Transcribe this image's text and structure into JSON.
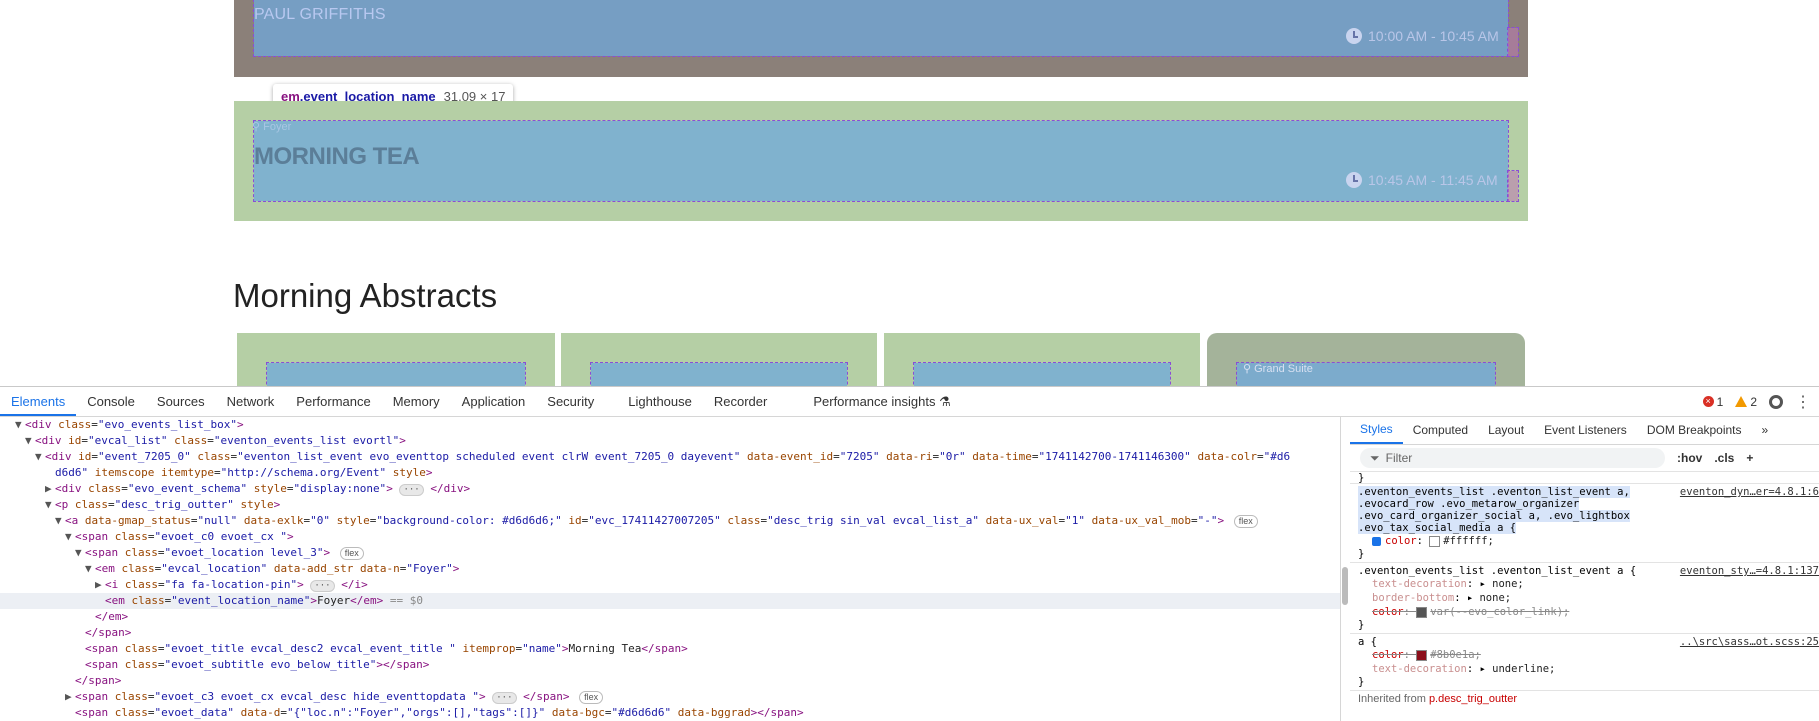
{
  "page": {
    "card1": {
      "organizer": "PAUL GRIFFITHS",
      "time": "10:00 AM - 10:45 AM"
    },
    "card2": {
      "location": "Foyer",
      "title": "MORNING TEA",
      "time": "10:45 AM - 11:45 AM"
    },
    "tooltip": {
      "tag": "em",
      "class": ".event_location_name",
      "dims": "31.09 × 17"
    },
    "section_heading": "Morning Abstracts",
    "abstract_cards": [
      {
        "color": "#b5cfa5",
        "label": ""
      },
      {
        "color": "#b5cfa5",
        "label": ""
      },
      {
        "color": "#b5cfa5",
        "label": ""
      },
      {
        "color": "#a4b39a",
        "label": "Grand Suite"
      }
    ]
  },
  "devtools": {
    "tabs": [
      "Elements",
      "Console",
      "Sources",
      "Network",
      "Performance",
      "Memory",
      "Application",
      "Security",
      "Lighthouse",
      "Recorder",
      "Performance insights"
    ],
    "active_tab": "Elements",
    "errors": "1",
    "warnings": "2",
    "style_tabs": [
      "Styles",
      "Computed",
      "Layout",
      "Event Listeners",
      "DOM Breakpoints"
    ],
    "filter_placeholder": "Filter",
    "filter_hov": ":hov",
    "filter_cls": ".cls",
    "dom_lines": [
      {
        "indent": 2,
        "tri": "▼",
        "html": "<span class=\"t\">&lt;div</span> <span class=\"an\">class</span>=<span class=\"av\">\"evo_events_list_box\"</span><span class=\"t\">&gt;</span>"
      },
      {
        "indent": 3,
        "tri": "▼",
        "html": "<span class=\"t\">&lt;div</span> <span class=\"an\">id</span>=<span class=\"av\">\"evcal_list\"</span> <span class=\"an\">class</span>=<span class=\"av\">\"eventon_events_list evortl\"</span><span class=\"t\">&gt;</span>"
      },
      {
        "indent": 4,
        "tri": "▼",
        "html": "<span class=\"t\">&lt;div</span> <span class=\"an\">id</span>=<span class=\"av\">\"event_7205_0\"</span> <span class=\"an\">class</span>=<span class=\"av\">\"eventon_list_event evo_eventtop scheduled event clrW event_7205_0 dayevent\"</span> <span class=\"an\">data-event_id</span>=<span class=\"av\">\"7205\"</span> <span class=\"an\">data-ri</span>=<span class=\"av\">\"0r\"</span> <span class=\"an\">data-time</span>=<span class=\"av\">\"1741142700-1741146300\"</span> <span class=\"an\">data-colr</span>=<span class=\"av\">\"#d6</span>"
      },
      {
        "indent": 5,
        "tri": "",
        "html": "<span class=\"av\">d6d6\"</span> <span class=\"an\">itemscope</span> <span class=\"an\">itemtype</span>=<span class=\"av\">\"http://schema.org/Event\"</span> <span class=\"an\">style</span><span class=\"t\">&gt;</span>"
      },
      {
        "indent": 5,
        "tri": "▶",
        "html": "<span class=\"t\">&lt;div</span> <span class=\"an\">class</span>=<span class=\"av\">\"evo_event_schema\"</span> <span class=\"an\">style</span>=<span class=\"av\">\"display:none\"</span><span class=\"t\">&gt;</span> <span class=\"ell\">···</span> <span class=\"t\">&lt;/div&gt;</span>"
      },
      {
        "indent": 5,
        "tri": "▼",
        "html": "<span class=\"t\">&lt;p</span> <span class=\"an\">class</span>=<span class=\"av\">\"desc_trig_outter\"</span> <span class=\"an\">style</span><span class=\"t\">&gt;</span>"
      },
      {
        "indent": 6,
        "tri": "▼",
        "html": "<span class=\"t\">&lt;a</span> <span class=\"an\">data-gmap_status</span>=<span class=\"av\">\"null\"</span> <span class=\"an\">data-exlk</span>=<span class=\"av\">\"0\"</span> <span class=\"an\">style</span>=<span class=\"av\">\"background-color: #d6d6d6;\"</span> <span class=\"an\">id</span>=<span class=\"av\">\"evc_17411427007205\"</span> <span class=\"an\">class</span>=<span class=\"av\">\"desc_trig sin_val evcal_list_a\"</span> <span class=\"an\">data-ux_val</span>=<span class=\"av\">\"1\"</span> <span class=\"an\">data-ux_val_mob</span>=<span class=\"av\">\"-\"</span><span class=\"t\">&gt;</span> <span class=\"badge\">flex</span>"
      },
      {
        "indent": 7,
        "tri": "▼",
        "html": "<span class=\"t\">&lt;span</span> <span class=\"an\">class</span>=<span class=\"av\">\"evoet_c0 evoet_cx \"</span><span class=\"t\">&gt;</span>"
      },
      {
        "indent": 8,
        "tri": "▼",
        "html": "<span class=\"t\">&lt;span</span> <span class=\"an\">class</span>=<span class=\"av\">\"evoet_location level_3\"</span><span class=\"t\">&gt;</span> <span class=\"badge\">flex</span>"
      },
      {
        "indent": 9,
        "tri": "▼",
        "html": "<span class=\"t\">&lt;em</span> <span class=\"an\">class</span>=<span class=\"av\">\"evcal_location\"</span> <span class=\"an\">data-add_str</span> <span class=\"an\">data-n</span>=<span class=\"av\">\"Foyer\"</span><span class=\"t\">&gt;</span>"
      },
      {
        "indent": 10,
        "tri": "▶",
        "html": "<span class=\"t\">&lt;i</span> <span class=\"an\">class</span>=<span class=\"av\">\"fa fa-location-pin\"</span><span class=\"t\">&gt;</span> <span class=\"ell\">···</span> <span class=\"t\">&lt;/i&gt;</span>"
      },
      {
        "indent": 10,
        "tri": "",
        "selected": true,
        "html": "<span class=\"t\">&lt;em</span> <span class=\"an\">class</span>=<span class=\"av\">\"event_location_name\"</span><span class=\"t\">&gt;</span><span class=\"txt\">Foyer</span><span class=\"t\">&lt;/em&gt;</span> <span class=\"dollar\">== $0</span>"
      },
      {
        "indent": 9,
        "tri": "",
        "html": "<span class=\"t\">&lt;/em&gt;</span>"
      },
      {
        "indent": 8,
        "tri": "",
        "html": "<span class=\"t\">&lt;/span&gt;</span>"
      },
      {
        "indent": 8,
        "tri": "",
        "html": "<span class=\"t\">&lt;span</span> <span class=\"an\">class</span>=<span class=\"av\">\"evoet_title evcal_desc2 evcal_event_title \"</span> <span class=\"an\">itemprop</span>=<span class=\"av\">\"name\"</span><span class=\"t\">&gt;</span><span class=\"txt\">Morning Tea</span><span class=\"t\">&lt;/span&gt;</span>"
      },
      {
        "indent": 8,
        "tri": "",
        "html": "<span class=\"t\">&lt;span</span> <span class=\"an\">class</span>=<span class=\"av\">\"evoet_subtitle evo_below_title\"</span><span class=\"t\">&gt;&lt;/span&gt;</span>"
      },
      {
        "indent": 7,
        "tri": "",
        "html": "<span class=\"t\">&lt;/span&gt;</span>"
      },
      {
        "indent": 7,
        "tri": "▶",
        "html": "<span class=\"t\">&lt;span</span> <span class=\"an\">class</span>=<span class=\"av\">\"evoet_c3 evoet_cx evcal_desc hide_eventtopdata \"</span><span class=\"t\">&gt;</span> <span class=\"ell\">···</span> <span class=\"t\">&lt;/span&gt;</span> <span class=\"badge\">flex</span>"
      },
      {
        "indent": 7,
        "tri": "",
        "html": "<span class=\"t\">&lt;span</span> <span class=\"an\">class</span>=<span class=\"av\">\"evoet_data\"</span> <span class=\"an\">data-d</span>=<span class=\"av\">\"{\"loc.n\":\"Foyer\",\"orgs\":[],\"tags\":[]}\"</span> <span class=\"an\">data-bgc</span>=<span class=\"av\">\"#d6d6d6\"</span> <span class=\"an\">data-bggrad</span><span class=\"t\">&gt;&lt;/span&gt;</span>"
      }
    ],
    "styles": {
      "rule1_selector": ".eventon_events_list .eventon_list_event a, .evocard_row .evo_metarow_organizer .evo_card_organizer_social a, .evo_lightbox .evo_tax_social_media a {",
      "rule1_source": "eventon_dyn…er=4.8.1:6",
      "rule1_prop": "color",
      "rule1_value": "#ffffff;",
      "rule2_selector": ".eventon_events_list .eventon_list_event a {",
      "rule2_source": "eventon_sty…=4.8.1:137",
      "rule2_props": [
        {
          "name": "text-decoration",
          "value": "none;"
        },
        {
          "name": "border-bottom",
          "value": "none;"
        },
        {
          "name": "color",
          "value": "var(--evo_color_link);"
        }
      ],
      "rule3_selector": "a {",
      "rule3_source": "..\\src\\sass…ot.scss:25",
      "rule3_props": [
        {
          "name": "color",
          "value": "#8b0e1a;"
        },
        {
          "name": "text-decoration",
          "value": "underline;"
        }
      ],
      "inherited_label": "Inherited from",
      "inherited_from": "p.desc_trig_outter"
    }
  }
}
